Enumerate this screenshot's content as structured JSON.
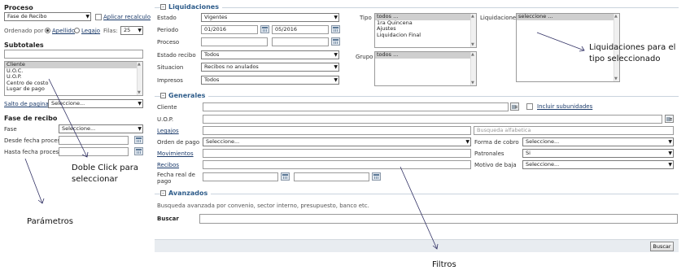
{
  "left_panel": {
    "proceso_title": "Proceso",
    "proceso_value": "Fase de Recibo",
    "aplicar_recalculo": "Aplicar recalculo",
    "ordenado_por": "Ordenado por",
    "apellido": "Apellido",
    "legajo": "Legajo",
    "filas_label": "Filas:",
    "filas_value": "25",
    "subtotales_title": "Subtotales",
    "subtotales_items": [
      "Cliente",
      "U.O.C.",
      "U.O.P.",
      "Centro de costo",
      "Lugar de pago"
    ],
    "salto_de_pagina": "Salto de pagina",
    "salto_value": "Seleccione...",
    "fase_recibo_title": "Fase de recibo",
    "fase_label": "Fase",
    "fase_value": "Seleccione...",
    "desde_label": "Desde fecha proceso",
    "hasta_label": "Hasta fecha proceso"
  },
  "liquidaciones": {
    "title": "Liquidaciones",
    "estado_label": "Estado",
    "estado_value": "Vigentes",
    "periodo_label": "Periodo",
    "periodo_from": "01/2016",
    "periodo_to": "05/2016",
    "proceso_label": "Proceso",
    "estado_recibo_label": "Estado recibo",
    "estado_recibo_value": "Todos",
    "situacion_label": "Situacion",
    "situacion_value": "Recibos no anulados",
    "impresos_label": "Impresos",
    "impresos_value": "Todos",
    "tipo_label": "Tipo",
    "tipo_items": [
      "todos ...",
      "1ra Quincena",
      "Ajustes",
      "Liquidacion Final"
    ],
    "grupo_label": "Grupo",
    "grupo_items": [
      "todos ..."
    ],
    "liquidaciones_label": "Liquidaciones",
    "liquidaciones_items": [
      "seleccione ..."
    ]
  },
  "generales": {
    "title": "Generales",
    "cliente_label": "Cliente",
    "incluir_subunidades": "Incluir subunidades",
    "uop_label": "U.O.P.",
    "legajos_label": "Legajos",
    "busqueda_placeholder": "Busqueda alfabetica",
    "orden_pago_label": "Orden de pago",
    "orden_pago_value": "Seleccione...",
    "forma_cobro_label": "Forma de cobro",
    "forma_cobro_value": "Seleccione...",
    "movimientos_label": "Movimientos",
    "patronales_label": "Patronales",
    "patronales_value": "Si",
    "recibos_label": "Recibos",
    "motivo_baja_label": "Motivo de baja",
    "motivo_baja_value": "Seleccione...",
    "fecha_real_label_1": "Fecha real de",
    "fecha_real_label_2": "pago"
  },
  "avanzados": {
    "title": "Avanzados",
    "description": "Busqueda avanzada por convenio, sector interno, presupuesto, banco etc.",
    "buscar_label": "Buscar",
    "buscar_button": "Buscar"
  },
  "annotations": {
    "liquidaciones_1": "Liquidaciones para el",
    "liquidaciones_2": "tipo seleccionado",
    "doble_click_1": "Doble Click para",
    "doble_click_2": "seleccionar",
    "parametros": "Parámetros",
    "filtros": "Filtros"
  }
}
